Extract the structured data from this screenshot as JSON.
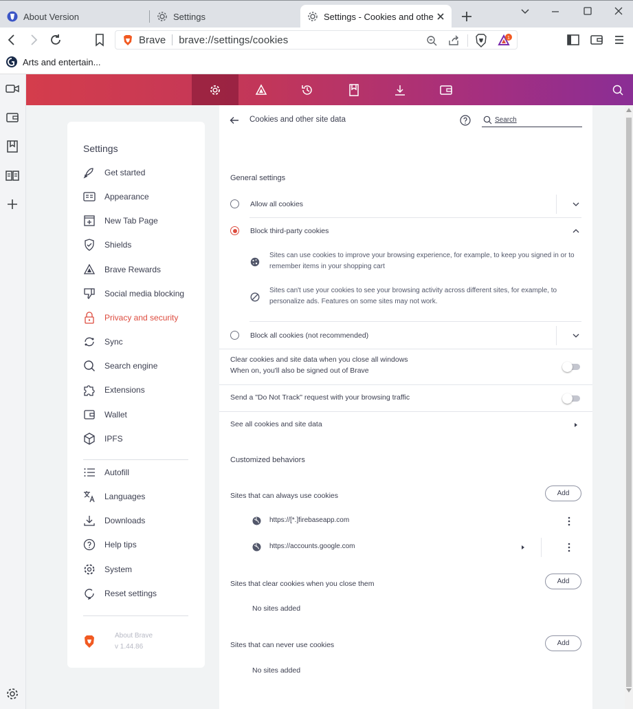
{
  "window": {
    "tabs": [
      {
        "label": "About Version",
        "icon": "brave-shield-icon",
        "active": false
      },
      {
        "label": "Settings",
        "icon": "gear-icon",
        "active": false
      },
      {
        "label": "Settings - Cookies and other s",
        "icon": "gear-icon",
        "active": true
      }
    ]
  },
  "toolbar": {
    "omnibox_brand": "Brave",
    "url": "brave://settings/cookies",
    "rewards_badge": "1"
  },
  "bookmarks": {
    "items": [
      {
        "label": "Arts and entertain...",
        "icon": "site-favicon-icon"
      }
    ]
  },
  "settings_nav": {
    "title": "Settings",
    "items": [
      {
        "label": "Get started",
        "icon": "rocket-icon"
      },
      {
        "label": "Appearance",
        "icon": "appearance-icon"
      },
      {
        "label": "New Tab Page",
        "icon": "new-tab-icon"
      },
      {
        "label": "Shields",
        "icon": "shield-check-icon"
      },
      {
        "label": "Brave Rewards",
        "icon": "rewards-triangle-icon"
      },
      {
        "label": "Social media blocking",
        "icon": "thumbs-down-icon"
      },
      {
        "label": "Privacy and security",
        "icon": "lock-icon",
        "active": true
      },
      {
        "label": "Sync",
        "icon": "sync-icon"
      },
      {
        "label": "Search engine",
        "icon": "search-icon"
      },
      {
        "label": "Extensions",
        "icon": "puzzle-icon"
      },
      {
        "label": "Wallet",
        "icon": "wallet-icon"
      },
      {
        "label": "IPFS",
        "icon": "cube-icon"
      },
      {
        "label": "Autofill",
        "icon": "list-icon"
      },
      {
        "label": "Languages",
        "icon": "translate-icon"
      },
      {
        "label": "Downloads",
        "icon": "download-icon"
      },
      {
        "label": "Help tips",
        "icon": "help-icon"
      },
      {
        "label": "System",
        "icon": "gear-icon"
      },
      {
        "label": "Reset settings",
        "icon": "reset-icon"
      }
    ],
    "about_title": "About Brave",
    "about_version": "v 1.44.86"
  },
  "page": {
    "title": "Cookies and other site data",
    "search_placeholder": "Search",
    "general_title": "General settings",
    "allow_all": "Allow all cookies",
    "block_third_party": "Block third-party cookies",
    "block_third_party_detail_1": "Sites can use cookies to improve your browsing experience, for example, to keep you signed in or to remember items in your shopping cart",
    "block_third_party_detail_2": "Sites can't use your cookies to see your browsing activity across different sites, for example, to personalize ads. Features on some sites may not work.",
    "block_all": "Block all cookies (not recommended)",
    "clear_on_exit_title": "Clear cookies and site data when you close all windows",
    "clear_on_exit_sub": "When on, you'll also be signed out of Brave",
    "clear_on_exit_on": false,
    "dnt_label": "Send a \"Do Not Track\" request with your browsing traffic",
    "dnt_on": false,
    "see_all": "See all cookies and site data",
    "customized_title": "Customized behaviors",
    "always_title": "Sites that can always use cookies",
    "always_sites": [
      "https://[*.]firebaseapp.com",
      "https://accounts.google.com"
    ],
    "clear_title": "Sites that clear cookies when you close them",
    "clear_empty": "No sites added",
    "never_title": "Sites that can never use cookies",
    "never_empty": "No sites added",
    "add_label": "Add"
  },
  "colors": {
    "accent": "#dd4b3e",
    "header_start": "#d43d4c",
    "header_end": "#8a2e95"
  }
}
